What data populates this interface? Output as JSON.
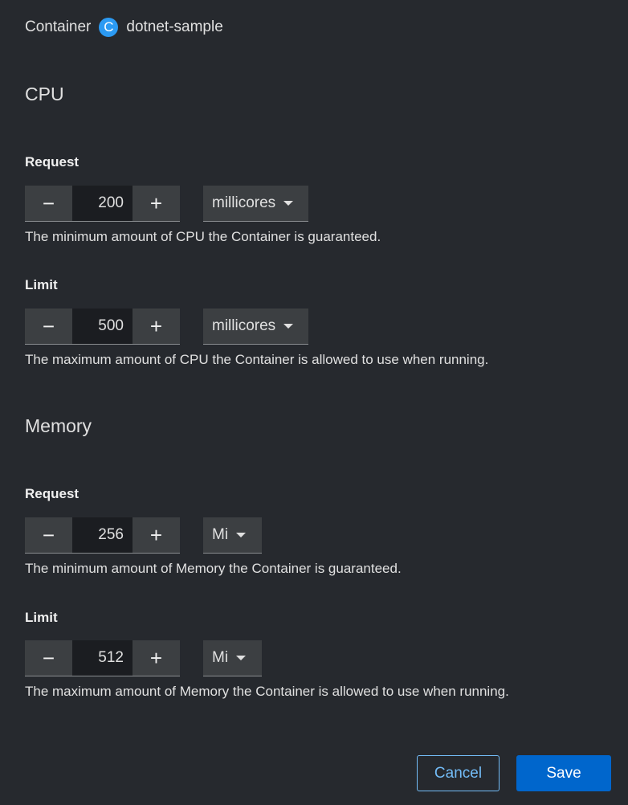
{
  "header": {
    "kind_label": "Container",
    "badge_letter": "C",
    "name": "dotnet-sample"
  },
  "cpu": {
    "title": "CPU",
    "request": {
      "label": "Request",
      "value": "200",
      "unit": "millicores",
      "help": "The minimum amount of CPU the Container is guaranteed."
    },
    "limit": {
      "label": "Limit",
      "value": "500",
      "unit": "millicores",
      "help": "The maximum amount of CPU the Container is allowed to use when running."
    }
  },
  "memory": {
    "title": "Memory",
    "request": {
      "label": "Request",
      "value": "256",
      "unit": "Mi",
      "help": "The minimum amount of Memory the Container is guaranteed."
    },
    "limit": {
      "label": "Limit",
      "value": "512",
      "unit": "Mi",
      "help": "The maximum amount of Memory the Container is allowed to use when running."
    }
  },
  "icons": {
    "minus": "−",
    "plus": "+"
  },
  "actions": {
    "cancel": "Cancel",
    "save": "Save"
  },
  "colors": {
    "accent": "#0066cc",
    "link": "#73bcf7",
    "badge": "#2b9af3"
  }
}
